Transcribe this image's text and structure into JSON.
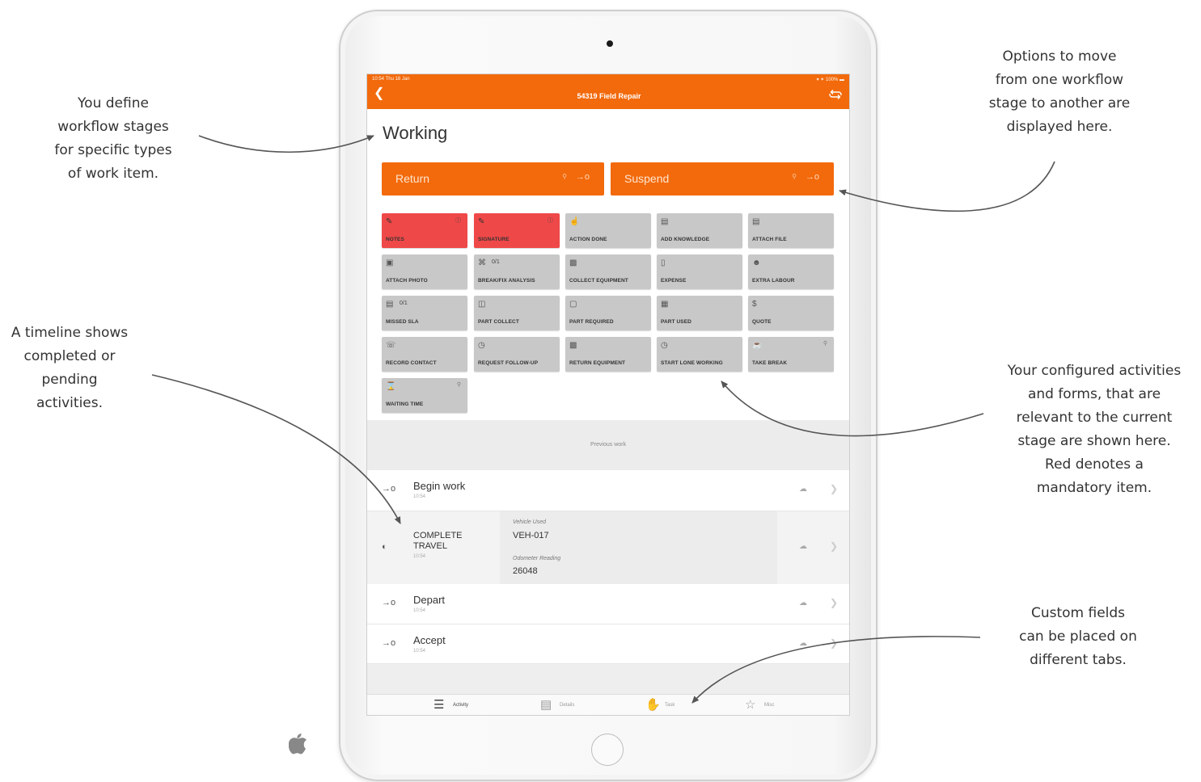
{
  "annotations": {
    "workflow_stages": [
      "You define",
      "workflow stages",
      "for specific types",
      "of work item."
    ],
    "transition_options": [
      "Options to move",
      "from one workflow",
      "stage to another are",
      "displayed here."
    ],
    "timeline": [
      "A timeline shows",
      "completed or",
      "pending",
      "activities."
    ],
    "activities": [
      "Your configured activities",
      "and forms, that are",
      "relevant to the current",
      "stage are shown here.",
      "Red denotes a",
      "mandatory item."
    ],
    "custom_fields": [
      "Custom fields",
      "can be placed on",
      "different tabs."
    ]
  },
  "status_bar": {
    "left": "10:54  Thu 18 Jan",
    "right": "▾ ✶ 100% ▬"
  },
  "app_bar": {
    "back_icon": "chevron-left-icon",
    "title": "54319 Field Repair",
    "sync_icon": "sync-icon"
  },
  "stage": {
    "title": "Working"
  },
  "transitions": [
    {
      "label": "Return",
      "icon": "location-pin-icon",
      "action_icon": "arrow-transition-icon"
    },
    {
      "label": "Suspend",
      "icon": "location-pin-icon",
      "action_icon": "arrow-transition-icon"
    }
  ],
  "activities": [
    {
      "label": "NOTES",
      "icon": "notes-icon",
      "mandatory": true,
      "count": ""
    },
    {
      "label": "SIGNATURE",
      "icon": "signature-icon",
      "mandatory": true,
      "count": ""
    },
    {
      "label": "ACTION DONE",
      "icon": "hand-pointer-icon",
      "mandatory": false,
      "count": ""
    },
    {
      "label": "ADD KNOWLEDGE",
      "icon": "document-icon",
      "mandatory": false,
      "count": ""
    },
    {
      "label": "ATTACH FILE",
      "icon": "file-icon",
      "mandatory": false,
      "count": ""
    },
    {
      "label": "ATTACH PHOTO",
      "icon": "camera-icon",
      "mandatory": false,
      "count": ""
    },
    {
      "label": "BREAK/FIX ANALYSIS",
      "icon": "wrench-icon",
      "mandatory": false,
      "count": "0/1"
    },
    {
      "label": "COLLECT EQUIPMENT",
      "icon": "equipment-icon",
      "mandatory": false,
      "count": ""
    },
    {
      "label": "EXPENSE",
      "icon": "money-icon",
      "mandatory": false,
      "count": ""
    },
    {
      "label": "EXTRA LABOUR",
      "icon": "worker-icon",
      "mandatory": false,
      "count": ""
    },
    {
      "label": "MISSED SLA",
      "icon": "sla-icon",
      "mandatory": false,
      "count": "0/1"
    },
    {
      "label": "PART COLLECT",
      "icon": "boxes-icon",
      "mandatory": false,
      "count": ""
    },
    {
      "label": "PART REQUIRED",
      "icon": "box-icon",
      "mandatory": false,
      "count": ""
    },
    {
      "label": "PART USED",
      "icon": "barcode-icon",
      "mandatory": false,
      "count": ""
    },
    {
      "label": "QUOTE",
      "icon": "dollar-icon",
      "mandatory": false,
      "count": ""
    },
    {
      "label": "RECORD CONTACT",
      "icon": "contact-icon",
      "mandatory": false,
      "count": ""
    },
    {
      "label": "REQUEST FOLLOW-UP",
      "icon": "alarm-icon",
      "mandatory": false,
      "count": ""
    },
    {
      "label": "RETURN EQUIPMENT",
      "icon": "equipment-icon",
      "mandatory": false,
      "count": ""
    },
    {
      "label": "START LONE WORKING",
      "icon": "alarm-icon",
      "mandatory": false,
      "count": ""
    },
    {
      "label": "TAKE BREAK",
      "icon": "coffee-icon",
      "mandatory": false,
      "count": ""
    },
    {
      "label": "WAITING TIME",
      "icon": "hourglass-icon",
      "mandatory": false,
      "count": ""
    }
  ],
  "previous_work": {
    "label": "Previous work"
  },
  "timeline": [
    {
      "name": "Begin work",
      "time": "10:54",
      "icon": "arrow-transition-icon"
    },
    {
      "name": "COMPLETE TRAVEL",
      "time": "10:54",
      "icon": "car-icon",
      "fields": [
        {
          "label": "Vehicle Used",
          "value": "VEH-017"
        },
        {
          "label": "Odometer Reading",
          "value": "26048"
        }
      ]
    },
    {
      "name": "Depart",
      "time": "10:54",
      "icon": "arrow-transition-icon"
    },
    {
      "name": "Accept",
      "time": "10:54",
      "icon": "arrow-transition-icon"
    }
  ],
  "row_icons": {
    "cloud": "cloud-upload-icon",
    "chevron": "chevron-right-icon"
  },
  "tabs": [
    {
      "label": "Activity",
      "icon": "list-icon",
      "active": true
    },
    {
      "label": "Details",
      "icon": "document-icon",
      "active": false
    },
    {
      "label": "Task",
      "icon": "hand-icon",
      "active": false
    },
    {
      "label": "Misc",
      "icon": "star-icon",
      "active": false
    }
  ],
  "colors": {
    "accent": "#f26a0c",
    "mandatory": "#ef4848",
    "tile": "#c8c8c8"
  }
}
